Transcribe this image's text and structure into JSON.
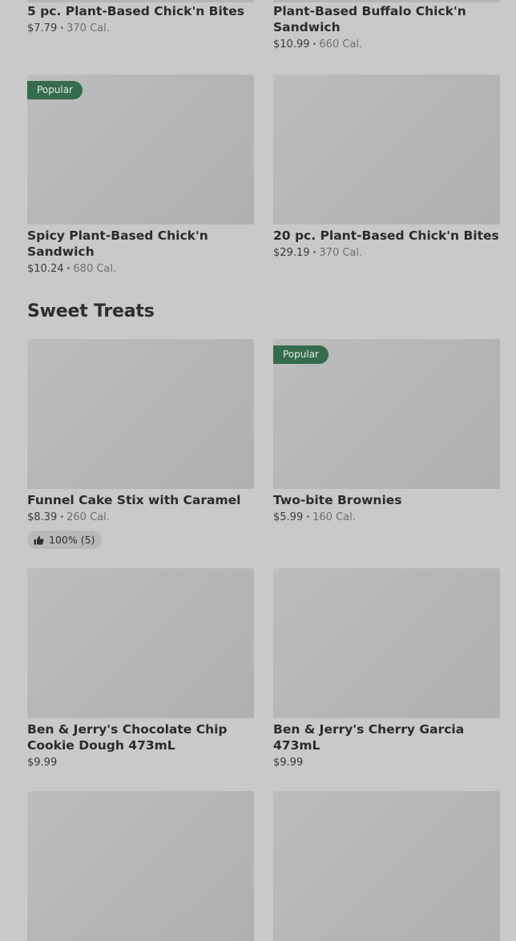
{
  "top_row": [
    {
      "title": "5 pc. Plant-Based Chick'n Bites",
      "price": "$7.79",
      "calories": "370 Cal."
    },
    {
      "title": "Plant-Based Buffalo Chick'n Sandwich",
      "price": "$10.99",
      "calories": "660 Cal."
    }
  ],
  "row2": [
    {
      "badge": "Popular",
      "title": "Spicy Plant-Based Chick'n Sandwich",
      "price": "$10.24",
      "calories": "680 Cal."
    },
    {
      "title": "20 pc. Plant-Based Chick'n Bites",
      "price": "$29.19",
      "calories": "370 Cal."
    }
  ],
  "section": {
    "title": "Sweet Treats"
  },
  "row3": [
    {
      "title": "Funnel Cake Stix with Caramel",
      "price": "$8.39",
      "calories": "260 Cal.",
      "rating": "100% (5)"
    },
    {
      "badge": "Popular",
      "title": "Two-bite Brownies",
      "price": "$5.99",
      "calories": "160 Cal."
    }
  ],
  "row4": [
    {
      "title": "Ben & Jerry's Chocolate Chip Cookie Dough 473mL",
      "price": "$9.99"
    },
    {
      "title": "Ben & Jerry's Cherry Garcia 473mL",
      "price": "$9.99"
    }
  ],
  "icons": {
    "rating": "thumbs-up-icon"
  }
}
